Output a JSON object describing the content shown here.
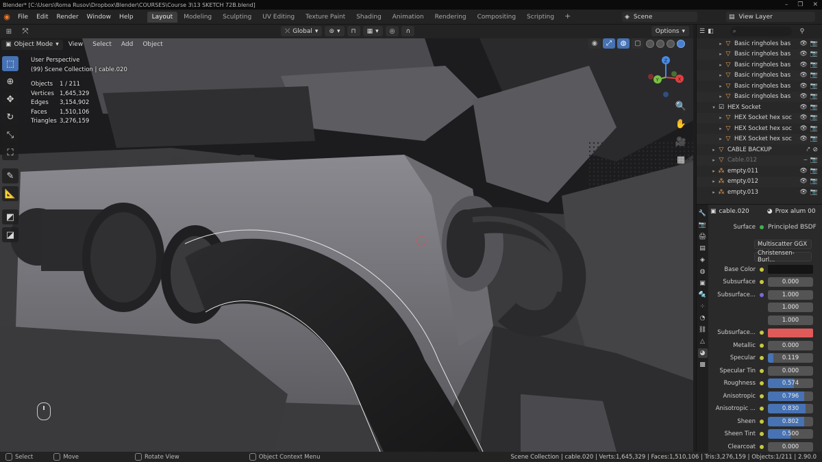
{
  "titlebar": {
    "text": "Blender* [C:\\Users\\Roma Rusov\\Dropbox\\Blender\\COURSES\\Course 3\\13 SKETCH 72B.blend]",
    "controls": [
      "–",
      "❐",
      "✕"
    ]
  },
  "menubar": {
    "menus": [
      "File",
      "Edit",
      "Render",
      "Window",
      "Help"
    ],
    "workspaces": [
      "Layout",
      "Modeling",
      "Sculpting",
      "UV Editing",
      "Texture Paint",
      "Shading",
      "Animation",
      "Rendering",
      "Compositing",
      "Scripting"
    ],
    "active_workspace": "Layout",
    "scene": "Scene",
    "view_layer": "View Layer"
  },
  "tool_header": {
    "orientation": "Global",
    "options": "Options"
  },
  "viewport_header": {
    "mode": "Object Mode",
    "menus": [
      "View",
      "Select",
      "Add",
      "Object"
    ]
  },
  "overlay": {
    "view_name": "User Perspective",
    "collection_line": "(99) Scene Collection | cable.020",
    "stats": [
      {
        "k": "Objects",
        "v": "1 / 211"
      },
      {
        "k": "Vertices",
        "v": "1,645,329"
      },
      {
        "k": "Edges",
        "v": "3,154,902"
      },
      {
        "k": "Faces",
        "v": "1,510,106"
      },
      {
        "k": "Triangles",
        "v": "3,276,159"
      }
    ]
  },
  "gizmo": {
    "x": "X",
    "y": "Y",
    "z": "Z"
  },
  "outliner": {
    "search_placeholder": "",
    "rows": [
      {
        "label": "Basic ringholes bas",
        "icon": "mesh"
      },
      {
        "label": "Basic ringholes bas",
        "icon": "mesh"
      },
      {
        "label": "Basic ringholes bas",
        "icon": "mesh"
      },
      {
        "label": "Basic ringholes bas",
        "icon": "mesh"
      },
      {
        "label": "Basic ringholes bas",
        "icon": "mesh"
      },
      {
        "label": "Basic ringholes bas",
        "icon": "mesh"
      },
      {
        "label": "HEX Socket",
        "icon": "coll"
      },
      {
        "label": "HEX Socket hex soc",
        "icon": "mesh"
      },
      {
        "label": "HEX Socket hex soc",
        "icon": "mesh"
      },
      {
        "label": "HEX Socket hex soc",
        "icon": "mesh"
      },
      {
        "label": "CABLE BACKUP",
        "icon": "coll"
      },
      {
        "label": "Cable.012",
        "icon": "mesh"
      },
      {
        "label": "empty.011",
        "icon": "empty"
      },
      {
        "label": "empty.012",
        "icon": "empty"
      },
      {
        "label": "empty.013",
        "icon": "empty"
      }
    ]
  },
  "properties": {
    "object_name": "cable.020",
    "material_name": "Prox alum 00",
    "surface_label": "Surface",
    "surface_value": "Principled BSDF",
    "distribution": "Multiscatter GGX",
    "subsurface_method": "Christensen-Burl...",
    "base_color_label": "Base Color",
    "base_color": "#141414",
    "subsurface_color": "#e05a5a",
    "rows": [
      {
        "label": "Subsurface",
        "value": "0.000",
        "fill": 0
      },
      {
        "label": "Subsurface...",
        "value": "1.000",
        "fill": 0
      },
      {
        "label": "",
        "value": "1.000",
        "fill": 0
      },
      {
        "label": "",
        "value": "1.000",
        "fill": 0
      },
      {
        "label": "Subsurface...",
        "value": "",
        "fill": 0
      },
      {
        "label": "Metallic",
        "value": "0.000",
        "fill": 0
      },
      {
        "label": "Specular",
        "value": "0.119",
        "fill": 0.119
      },
      {
        "label": "Specular Tin",
        "value": "0.000",
        "fill": 0
      },
      {
        "label": "Roughness",
        "value": "0.574",
        "fill": 0.574
      },
      {
        "label": "Anisotropic",
        "value": "0.796",
        "fill": 0.796
      },
      {
        "label": "Anisotropic ...",
        "value": "0.830",
        "fill": 0.83
      },
      {
        "label": "Sheen",
        "value": "0.802",
        "fill": 0.802
      },
      {
        "label": "Sheen Tint",
        "value": "0.500",
        "fill": 0.5
      },
      {
        "label": "Clearcoat",
        "value": "0.000",
        "fill": 0
      }
    ]
  },
  "statusbar": {
    "items": [
      "Select",
      "Move",
      "Rotate View",
      "Object Context Menu"
    ],
    "right": "Scene Collection | cable.020 | Verts:1,645,329 | Faces:1,510,106 | Tris:3,276,159 | Objects:1/211 | 2.90.0"
  }
}
